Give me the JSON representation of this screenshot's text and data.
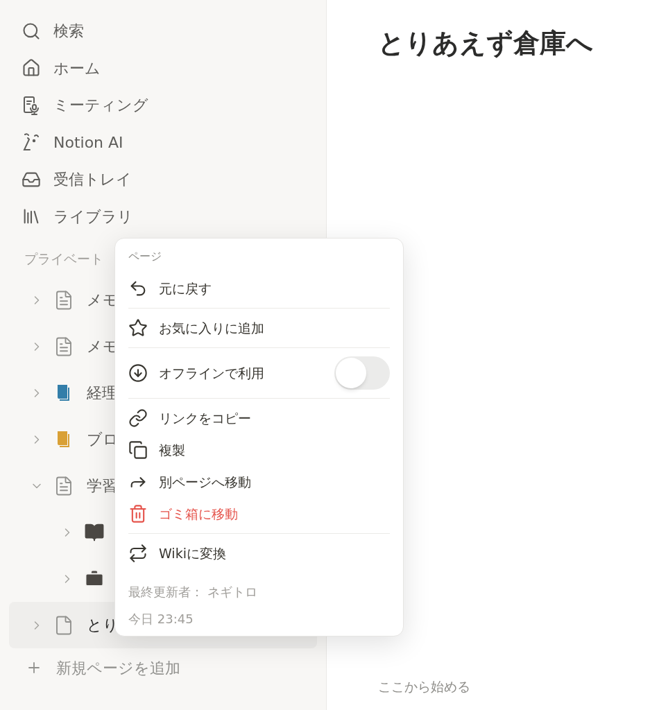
{
  "sidebar": {
    "nav": [
      {
        "kind": "search",
        "label": "検索"
      },
      {
        "kind": "home",
        "label": "ホーム"
      },
      {
        "kind": "meeting",
        "label": "ミーティング"
      },
      {
        "kind": "ai",
        "label": "Notion AI"
      },
      {
        "kind": "inbox",
        "label": "受信トレイ"
      },
      {
        "kind": "library",
        "label": "ライブラリ"
      }
    ],
    "section_label": "プライベート",
    "tree": [
      {
        "kind": "doc",
        "label": "メモ",
        "expanded": false,
        "selected": false
      },
      {
        "kind": "doc",
        "label": "メモ",
        "expanded": false,
        "selected": false
      },
      {
        "kind": "book",
        "color": "#337ea9",
        "label": "経理",
        "expanded": false,
        "selected": false
      },
      {
        "kind": "book",
        "color": "#d9a035",
        "label": "ブロ",
        "expanded": false,
        "selected": false
      },
      {
        "kind": "doc",
        "label": "学習",
        "expanded": true,
        "selected": false,
        "children": [
          {
            "kind": "openbook",
            "expanded": false
          },
          {
            "kind": "briefcase",
            "expanded": false
          }
        ]
      },
      {
        "kind": "blank",
        "label": "とり",
        "expanded": false,
        "selected": true
      }
    ],
    "add_page": "新規ページを追加"
  },
  "page": {
    "title": "とりあえず倉庫へ",
    "start_label": "ここから始める"
  },
  "menu": {
    "heading": "ページ",
    "sections": [
      [
        {
          "kind": "undo",
          "label": "元に戻す",
          "danger": false
        }
      ],
      [
        {
          "kind": "star",
          "label": "お気に入りに追加",
          "danger": false
        }
      ],
      [
        {
          "kind": "toggle",
          "label": "オフラインで利用",
          "on": false
        }
      ],
      [
        {
          "kind": "link",
          "label": "リンクをコピー",
          "danger": false
        },
        {
          "kind": "copy",
          "label": "複製",
          "danger": false
        },
        {
          "kind": "move",
          "label": "別ページへ移動",
          "danger": false
        },
        {
          "kind": "trash",
          "label": "ゴミ箱に移動",
          "danger": true
        }
      ],
      [
        {
          "kind": "convert",
          "label": "Wikiに変換",
          "danger": false
        }
      ]
    ],
    "footer": {
      "edited_by": "最終更新者： ネギトロ",
      "time": "今日 23:45"
    }
  }
}
